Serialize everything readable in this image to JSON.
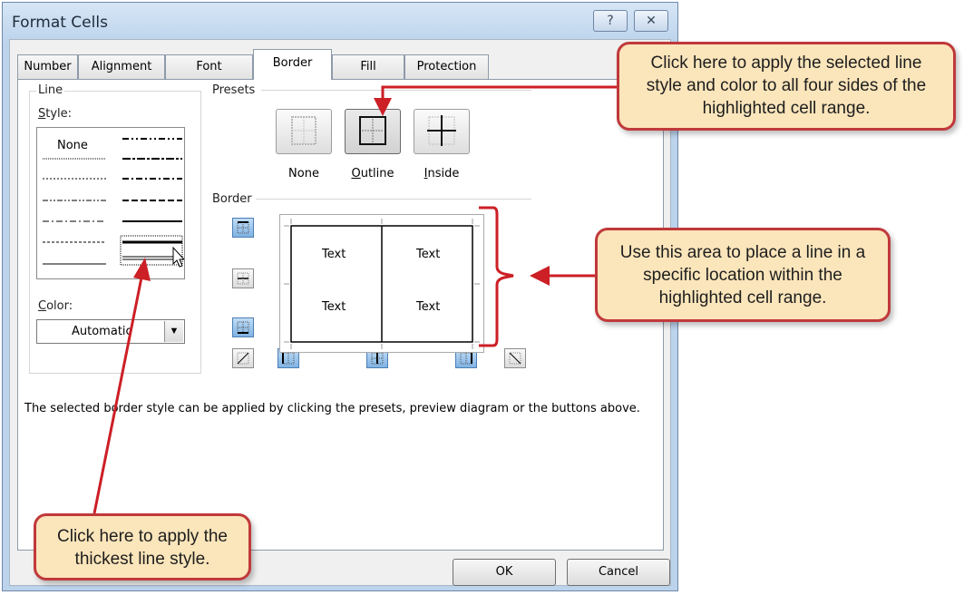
{
  "dialog": {
    "title": "Format Cells",
    "help_glyph": "?",
    "close_glyph": "✕"
  },
  "tabs": [
    {
      "label": "Number"
    },
    {
      "label": "Alignment"
    },
    {
      "label": "Font"
    },
    {
      "label": "Border",
      "active": true
    },
    {
      "label": "Fill"
    },
    {
      "label": "Protection"
    }
  ],
  "line": {
    "group_label": "Line",
    "style_label_underlined": "S",
    "style_label_rest": "tyle:",
    "none_label": "None",
    "color_label_underlined": "C",
    "color_label_rest": "olor:",
    "color_value": "Automatic"
  },
  "presets": {
    "group_label": "Presets",
    "none_label": "None",
    "outline_label_underlined": "O",
    "outline_label_rest": "utline",
    "inside_label_underlined": "I",
    "inside_label_rest": "nside"
  },
  "border": {
    "group_label": "Border",
    "preview_cells": [
      "Text",
      "Text",
      "Text",
      "Text"
    ]
  },
  "footer_text": "The selected border style can be applied by clicking the presets, preview diagram or the buttons above.",
  "buttons": {
    "ok": "OK",
    "cancel": "Cancel"
  },
  "callouts": {
    "outline": "Click here to apply the selected line style and color to all four sides of the highlighted cell range.",
    "border_area": "Use this area to place a line in a specific location within the highlighted cell range.",
    "thick_line": "Click here to apply the thickest line style."
  },
  "colors": {
    "callout_fill": "#fbe5bb",
    "callout_border": "#c0393b",
    "arrow": "#cc1f26",
    "pressed_button": "#7fb3e4"
  }
}
